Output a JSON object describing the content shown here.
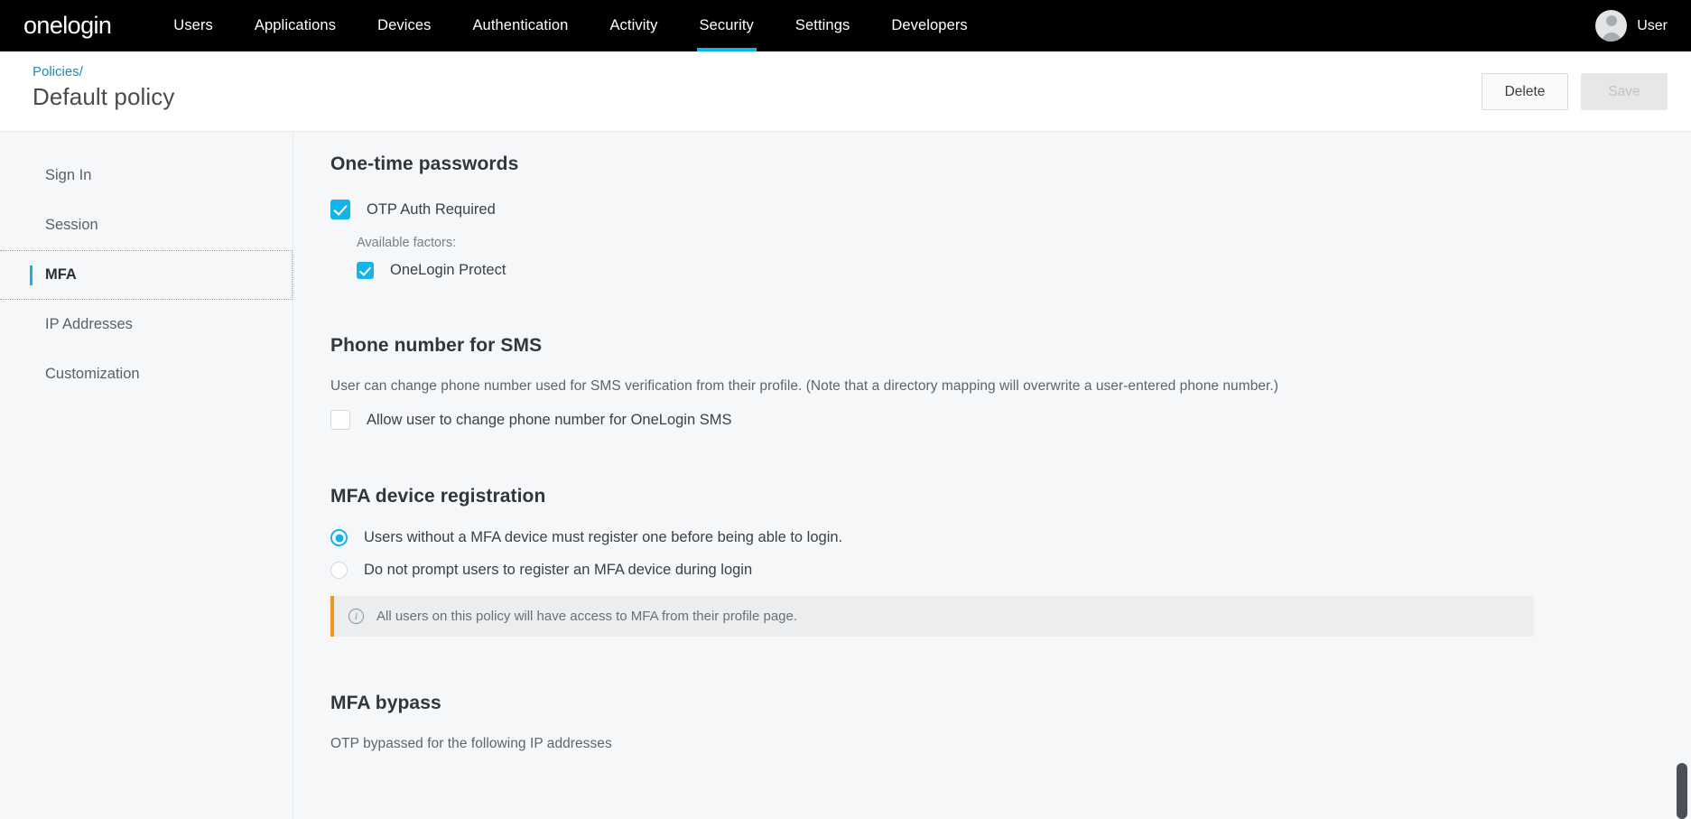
{
  "topnav": {
    "logo": "onelogin",
    "items": [
      {
        "label": "Users",
        "active": false
      },
      {
        "label": "Applications",
        "active": false
      },
      {
        "label": "Devices",
        "active": false
      },
      {
        "label": "Authentication",
        "active": false
      },
      {
        "label": "Activity",
        "active": false
      },
      {
        "label": "Security",
        "active": true
      },
      {
        "label": "Settings",
        "active": false
      },
      {
        "label": "Developers",
        "active": false
      }
    ],
    "user_label": "User",
    "accent_color": "#14b4e8"
  },
  "header": {
    "breadcrumb_text": "Policies",
    "breadcrumb_separator": "/",
    "title": "Default policy",
    "delete_label": "Delete",
    "save_label": "Save",
    "save_disabled": true
  },
  "sidebar": {
    "items": [
      {
        "label": "Sign In",
        "active": false
      },
      {
        "label": "Session",
        "active": false
      },
      {
        "label": "MFA",
        "active": true
      },
      {
        "label": "IP Addresses",
        "active": false
      },
      {
        "label": "Customization",
        "active": false
      }
    ]
  },
  "main": {
    "otp": {
      "title": "One-time passwords",
      "otp_required_label": "OTP Auth Required",
      "otp_required_checked": true,
      "available_factors_label": "Available factors:",
      "factor_label": "OneLogin Protect",
      "factor_checked": true
    },
    "sms": {
      "title": "Phone number for SMS",
      "description": "User can change phone number used for SMS verification from their profile. (Note that a directory mapping will overwrite a user-entered phone number.)",
      "allow_change_label": "Allow user to change phone number for OneLogin SMS",
      "allow_change_checked": false
    },
    "device_registration": {
      "title": "MFA device registration",
      "option_1_label": "Users without a MFA device must register one before being able to login.",
      "option_1_selected": true,
      "option_2_label": "Do not prompt users to register an MFA device during login",
      "option_2_selected": false,
      "notice_text": "All users on this policy will have access to MFA from their profile page.",
      "notice_accent": "#f59324"
    },
    "bypass": {
      "title": "MFA bypass",
      "description": "OTP bypassed for the following IP addresses"
    }
  }
}
